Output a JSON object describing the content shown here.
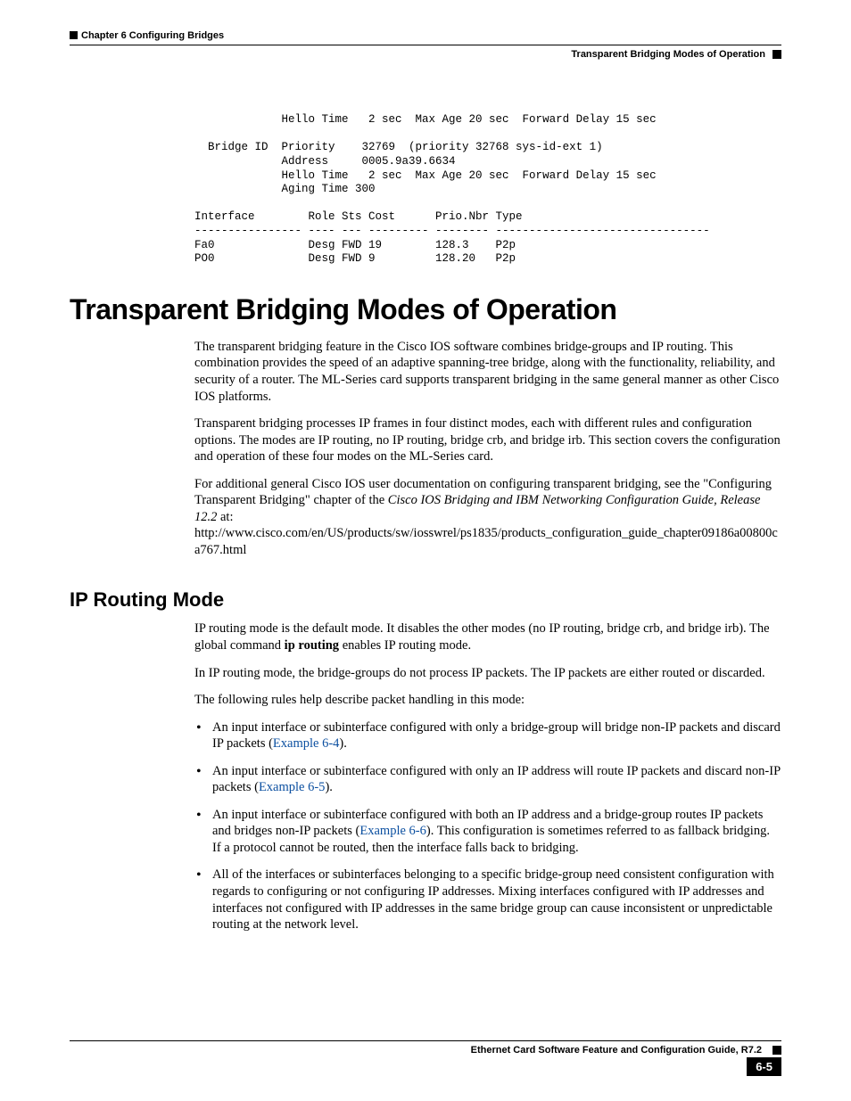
{
  "header": {
    "chapter": "Chapter 6  Configuring Bridges",
    "section": "Transparent Bridging Modes of Operation"
  },
  "terminal": "             Hello Time   2 sec  Max Age 20 sec  Forward Delay 15 sec\n\n  Bridge ID  Priority    32769  (priority 32768 sys-id-ext 1)\n             Address     0005.9a39.6634\n             Hello Time   2 sec  Max Age 20 sec  Forward Delay 15 sec\n             Aging Time 300\n\nInterface        Role Sts Cost      Prio.Nbr Type\n---------------- ---- --- --------- -------- --------------------------------\nFa0              Desg FWD 19        128.3    P2p\nPO0              Desg FWD 9         128.20   P2p",
  "h1": "Transparent Bridging Modes of Operation",
  "p1": "The transparent bridging feature in the Cisco IOS software combines bridge-groups and IP routing. This combination provides the speed of an adaptive spanning-tree bridge, along with the functionality, reliability, and security of a router. The ML-Series card supports transparent bridging in the same general manner as other Cisco IOS platforms.",
  "p2": "Transparent bridging processes IP frames in four distinct modes, each with different rules and configuration options. The modes are IP routing, no IP routing, bridge crb, and bridge irb. This section covers the configuration and operation of these four modes on the ML-Series card.",
  "p3a": "For additional general Cisco IOS user documentation on configuring transparent bridging, see the \"Configuring Transparent Bridging\" chapter of the ",
  "p3b": "Cisco IOS Bridging and IBM Networking Configuration Guide, Release 12.2",
  "p3c": " at:",
  "p3url": "http://www.cisco.com/en/US/products/sw/iosswrel/ps1835/products_configuration_guide_chapter09186a00800ca767.html",
  "h2": "IP Routing Mode",
  "p4a": "IP routing mode is the default mode. It disables the other modes (no IP routing, bridge crb, and bridge irb). The global command ",
  "p4b": "ip routing",
  "p4c": " enables IP routing mode.",
  "p5": "In IP routing mode, the bridge-groups do not process IP packets. The IP packets are either routed or discarded.",
  "p6": "The following rules help describe packet handling in this mode:",
  "b1a": "An input interface or subinterface configured with only a bridge-group will bridge non-IP packets and discard IP packets (",
  "b1link": "Example 6-4",
  "b1b": ").",
  "b2a": "An input interface or subinterface configured with only an IP address will route IP packets and discard non-IP packets (",
  "b2link": "Example 6-5",
  "b2b": ").",
  "b3a": "An input interface or subinterface configured with both an IP address and a bridge-group routes IP packets and bridges non-IP packets (",
  "b3link": "Example 6-6",
  "b3b": "). This configuration is sometimes referred to as fallback bridging. If a protocol cannot be routed, then the interface falls back to bridging.",
  "b4": "All of the interfaces or subinterfaces belonging to a specific bridge-group need consistent configuration with regards to configuring or not configuring IP addresses. Mixing interfaces configured with IP addresses and interfaces not configured with IP addresses in the same bridge group can cause inconsistent or unpredictable routing at the network level.",
  "footer": {
    "title": "Ethernet Card Software Feature and Configuration Guide, R7.2",
    "page": "6-5"
  }
}
